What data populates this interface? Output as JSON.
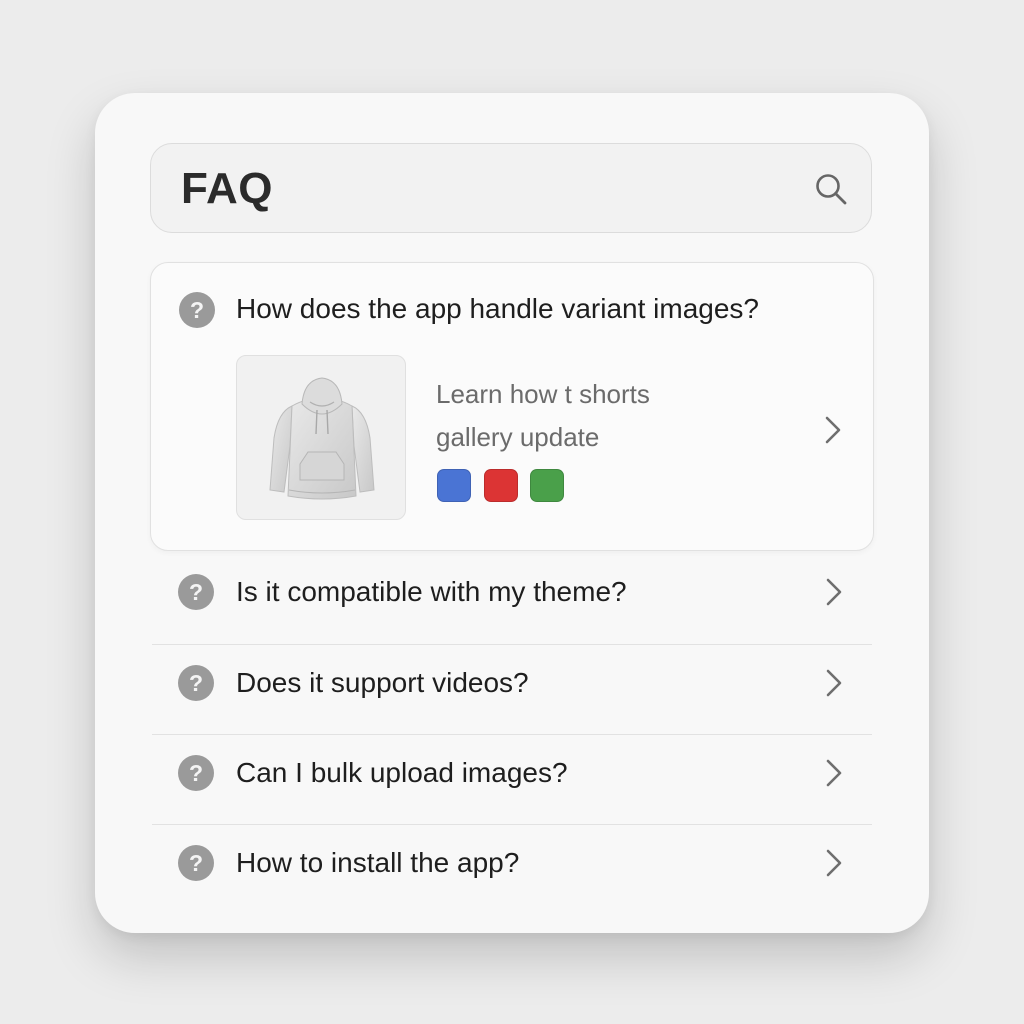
{
  "search": {
    "title": "FAQ",
    "icon": "search-icon"
  },
  "expanded_item": {
    "question": "How does the app handle variant images?",
    "preview_line_1": "Learn how t shorts",
    "preview_line_2": "gallery update",
    "thumbnail_icon": "hoodie-image",
    "swatches": [
      {
        "name": "blue",
        "color": "#4a74d4"
      },
      {
        "name": "red",
        "color": "#dc3434"
      },
      {
        "name": "green",
        "color": "#4aa04a"
      }
    ]
  },
  "faq_items": [
    {
      "question": "Is it compatible with my theme?"
    },
    {
      "question": "Does it support videos?"
    },
    {
      "question": "Can I bulk upload images?"
    },
    {
      "question": "How to install the app?"
    }
  ],
  "question_icon_glyph": "?",
  "colors": {
    "background": "#ececec",
    "card": "#f8f8f8",
    "question_icon": "#9a9a9a",
    "text": "#1e1e1e",
    "secondary_text": "#6b6b6b"
  }
}
